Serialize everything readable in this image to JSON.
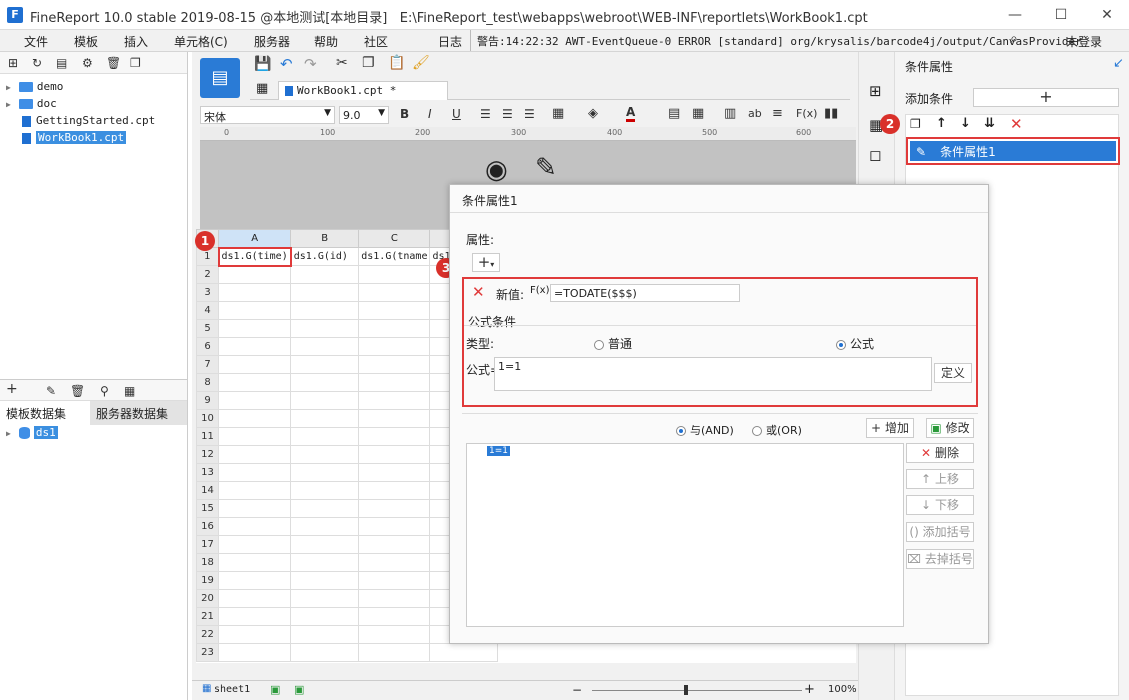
{
  "window": {
    "title": "FineReport 10.0 stable 2019-08-15 @本地测试[本地目录]",
    "path": "E:\\FineReport_test\\webapps\\webroot\\WEB-INF\\reportlets\\WorkBook1.cpt",
    "controls": {
      "minimize": "—",
      "maximize": "☐",
      "close": "✕"
    }
  },
  "menubar": {
    "items": [
      "文件",
      "模板",
      "插入",
      "单元格(C)",
      "服务器",
      "帮助",
      "社区"
    ],
    "log_label": "日志",
    "log_text": "警告:14:22:32 AWT-EventQueue-0 ERROR [standard] org/krysalis/barcode4j/output/CanvasProvider",
    "login": "未登录"
  },
  "left": {
    "tree": [
      "demo",
      "doc",
      "GettingStarted.cpt",
      "WorkBook1.cpt"
    ],
    "dataset_tabs": [
      "模板数据集",
      "服务器数据集"
    ],
    "datasets": [
      "ds1"
    ]
  },
  "editor": {
    "tab_title": "WorkBook1.cpt *",
    "font_name": "宋体",
    "font_size": "9.0",
    "ruler_ticks": [
      "0",
      "100",
      "200",
      "300",
      "400",
      "500",
      "600"
    ],
    "columns": [
      "A",
      "B",
      "C"
    ],
    "cells": [
      "ds1.G(time)",
      "ds1.G(id)",
      "ds1.G(tname",
      "ds1"
    ],
    "rows": [
      "1",
      "2",
      "3",
      "4",
      "5",
      "6",
      "7",
      "8",
      "9",
      "10",
      "11",
      "12",
      "13",
      "14",
      "15",
      "16",
      "17",
      "18",
      "19",
      "20",
      "21",
      "22",
      "23"
    ]
  },
  "status": {
    "sheet": "sheet1",
    "zoom": "100%"
  },
  "badges": [
    "1",
    "2",
    "3"
  ],
  "right_panel": {
    "title": "条件属性",
    "add_condition": "添加条件",
    "selected_item": "条件属性1"
  },
  "dialog": {
    "title": "条件属性1",
    "attr_label": "属性:",
    "new_value_label": "新值:",
    "formula_value": "=TODATE($$$)",
    "formula_condition_label": "公式条件",
    "type_label": "类型:",
    "type_normal": "普通",
    "type_formula": "公式",
    "formula_label": "公式=",
    "formula_text": "1=1",
    "define_btn": "定义",
    "and_label": "与(AND)",
    "or_label": "或(OR)",
    "add_btn": "增加",
    "modify_btn": "修改",
    "list_item": "1=1",
    "delete_btn": "删除",
    "up_btn": "上移",
    "down_btn": "下移",
    "add_bracket_btn": "添加括号",
    "remove_bracket_btn": "去掉括号"
  }
}
